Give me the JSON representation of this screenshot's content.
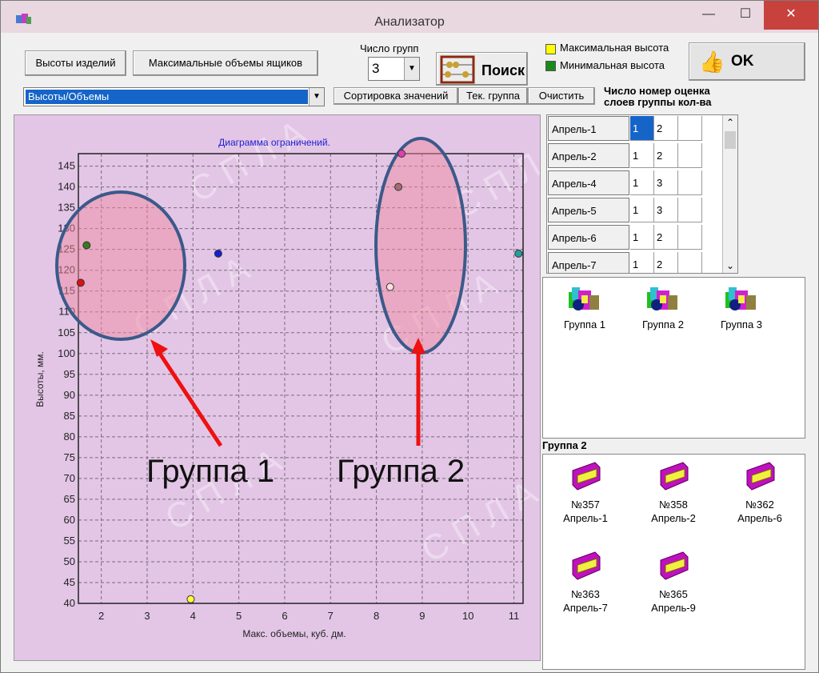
{
  "window": {
    "title": "Анализатор",
    "min": "—",
    "max": "☐",
    "close": "✕"
  },
  "toolbar": {
    "heights_btn": "Высоты изделий",
    "volumes_btn": "Максимальные объемы ящиков",
    "groups_count_label": "Число групп",
    "groups_count_value": "3",
    "search_btn": "Поиск",
    "legend_max": "Максимальная высота",
    "legend_min": "Минимальная высота",
    "legend_max_color": "#ffff00",
    "legend_min_color": "#1a8a1a",
    "ok_btn": "OK",
    "mode_value": "Высоты/Объемы",
    "sort_btn": "Сортировка значений",
    "cur_group_btn": "Тек. группа",
    "clear_btn": "Очистить",
    "table_header_line1": "Число номер оценка",
    "table_header_line2": "слоев группы кол-ва"
  },
  "table": {
    "rows": [
      {
        "name": "Апрель-1",
        "c1": "1",
        "c2": "2",
        "c3": ""
      },
      {
        "name": "Апрель-2",
        "c1": "1",
        "c2": "2",
        "c3": ""
      },
      {
        "name": "Апрель-4",
        "c1": "1",
        "c2": "3",
        "c3": ""
      },
      {
        "name": "Апрель-5",
        "c1": "1",
        "c2": "3",
        "c3": ""
      },
      {
        "name": "Апрель-6",
        "c1": "1",
        "c2": "2",
        "c3": ""
      },
      {
        "name": "Апрель-7",
        "c1": "1",
        "c2": "2",
        "c3": ""
      }
    ]
  },
  "groups": [
    "Группа 1",
    "Группа 2",
    "Группа 3"
  ],
  "items_header": "Группа 2",
  "items": [
    {
      "num": "№357",
      "name": "Апрель-1"
    },
    {
      "num": "№358",
      "name": "Апрель-2"
    },
    {
      "num": "№362",
      "name": "Апрель-6"
    },
    {
      "num": "№363",
      "name": "Апрель-7"
    },
    {
      "num": "№365",
      "name": "Апрель-9"
    }
  ],
  "annotations": {
    "group1": "Группа 1",
    "group2": "Группа 2"
  },
  "watermark": "С П Л А",
  "chart_data": {
    "type": "scatter",
    "title": "Диаграмма ограничений.",
    "xlabel": "Макс. объемы, куб. дм.",
    "ylabel": "Высоты, мм.",
    "xlim": [
      1.5,
      11.2
    ],
    "ylim": [
      40,
      148
    ],
    "xticks": [
      "2",
      "3",
      "4",
      "5",
      "6",
      "7",
      "8",
      "9",
      "10",
      "11"
    ],
    "yticks": [
      "40",
      "45",
      "50",
      "55",
      "60",
      "65",
      "70",
      "75",
      "80",
      "85",
      "90",
      "95",
      "100",
      "105",
      "110",
      "115",
      "120",
      "125",
      "130",
      "135",
      "140",
      "145"
    ],
    "grid": true,
    "points": [
      {
        "x": 1.55,
        "y": 117,
        "color": "#e01010"
      },
      {
        "x": 1.68,
        "y": 126,
        "color": "#3a7a20"
      },
      {
        "x": 4.55,
        "y": 124,
        "color": "#1020d0"
      },
      {
        "x": 3.95,
        "y": 41,
        "color": "#ffff40"
      },
      {
        "x": 8.55,
        "y": 148,
        "color": "#e040b0"
      },
      {
        "x": 8.48,
        "y": 140,
        "color": "#a07070"
      },
      {
        "x": 8.3,
        "y": 116,
        "color": "#ffe0e0"
      },
      {
        "x": 11.1,
        "y": 124,
        "color": "#20a0a0"
      }
    ]
  }
}
